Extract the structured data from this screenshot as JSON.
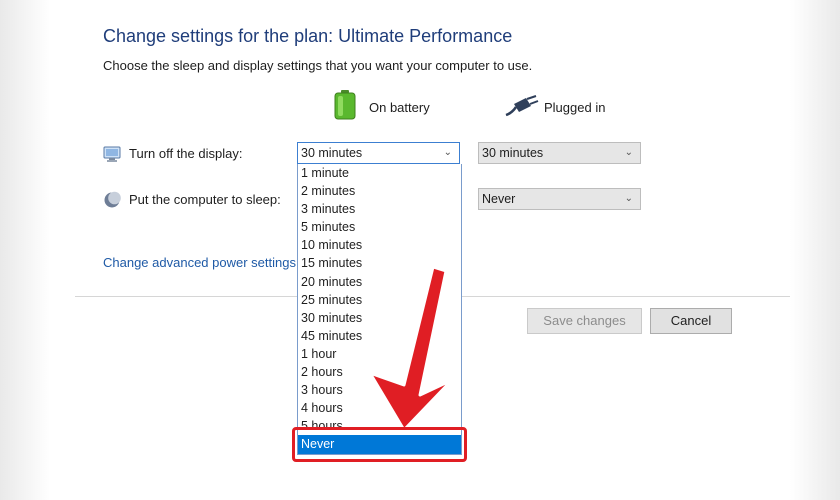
{
  "header": {
    "title": "Change settings for the plan: Ultimate Performance",
    "subtitle": "Choose the sleep and display settings that you want your computer to use."
  },
  "columns": {
    "battery": {
      "label": "On battery",
      "icon": "battery-icon"
    },
    "plugged": {
      "label": "Plugged in",
      "icon": "power-plug-icon"
    }
  },
  "settings": {
    "display": {
      "label": "Turn off the display:",
      "icon": "monitor-icon",
      "battery_value": "30 minutes",
      "plugged_value": "30 minutes"
    },
    "sleep": {
      "label": "Put the computer to sleep:",
      "icon": "moon-icon",
      "plugged_value": "Never"
    }
  },
  "dropdown": {
    "options": [
      "1 minute",
      "2 minutes",
      "3 minutes",
      "5 minutes",
      "10 minutes",
      "15 minutes",
      "20 minutes",
      "25 minutes",
      "30 minutes",
      "45 minutes",
      "1 hour",
      "2 hours",
      "3 hours",
      "4 hours",
      "5 hours",
      "Never"
    ],
    "highlighted": "Never"
  },
  "links": {
    "advanced": "Change advanced power settings"
  },
  "buttons": {
    "save": "Save changes",
    "cancel": "Cancel"
  },
  "colors": {
    "title": "#1f3d7a",
    "link": "#1f5aa6",
    "selection": "#0078d7",
    "annotation": "#e01e24"
  }
}
